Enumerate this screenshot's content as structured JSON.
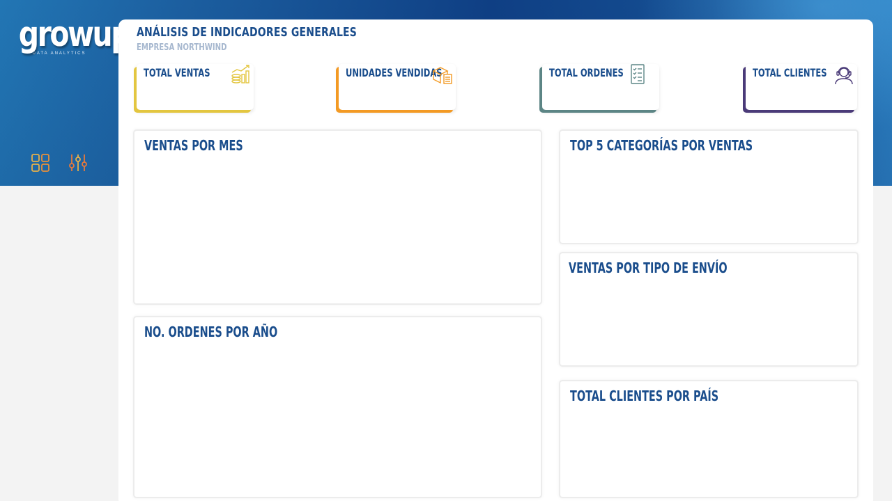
{
  "brand": {
    "logo_text": "growup",
    "logo_tagline": "DATA ANALYTICS"
  },
  "nav": {
    "items": [
      {
        "icon": "dashboard-grid-icon",
        "color": "#e8b04a"
      },
      {
        "icon": "filter-sliders-icon",
        "color": "#e87a3a"
      }
    ]
  },
  "header": {
    "title": "ANÁLISIS DE INDICADORES GENERALES",
    "subtitle": "EMPRESA NORTHWIND"
  },
  "kpis": [
    {
      "label": "TOTAL VENTAS",
      "icon": "money-growth-icon",
      "accent": "#e3c640"
    },
    {
      "label": "UNIDADES VENDIDAS",
      "icon": "boxes-list-icon",
      "accent": "#f39a24"
    },
    {
      "label": "TOTAL ORDENES",
      "icon": "checklist-icon",
      "accent": "#5c8585"
    },
    {
      "label": "TOTAL CLIENTES",
      "icon": "customer-support-icon",
      "accent": "#4a3a78"
    }
  ],
  "cards": {
    "ventas_mes": "VENTAS POR MES",
    "top5_categorias": "TOP 5 CATEGORÍAS POR VENTAS",
    "ventas_envio": "VENTAS POR TIPO DE ENVÍO",
    "ordenes_anio": "NO. ORDENES POR AÑO",
    "clientes_pais": "TOTAL CLIENTES POR PAÍS"
  },
  "colors": {
    "primary": "#1a4d8c",
    "subtitle": "#a7b8cf",
    "background": "#f3f3f3"
  }
}
